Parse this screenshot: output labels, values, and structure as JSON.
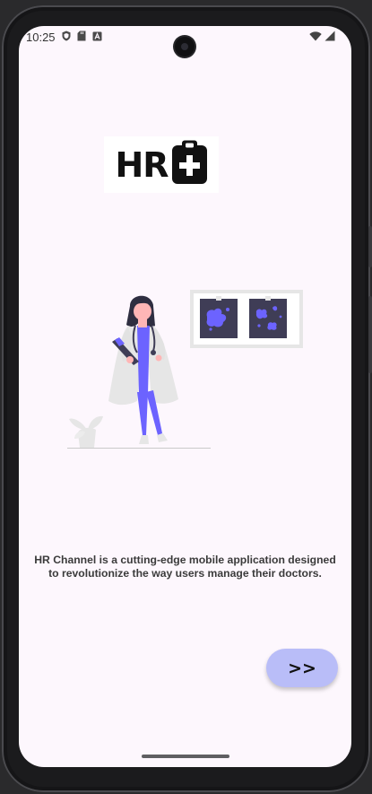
{
  "status_bar": {
    "time": "10:25",
    "left_icons": [
      "shield-icon",
      "sd-card-icon",
      "text-a-icon"
    ],
    "right_icons": [
      "wifi-icon",
      "cellular-signal-icon"
    ]
  },
  "logo": {
    "text": "HR",
    "icon": "medical-clipboard-icon"
  },
  "illustration": {
    "subject": "doctor-with-clipboard",
    "accent_color": "#6c63ff"
  },
  "description": "HR Channel is a cutting-edge mobile application designed to revolutionize the way users manage their doctors.",
  "next_button": {
    "label": ">>",
    "color": "#b9bdf8"
  },
  "colors": {
    "background": "#fdf7fd",
    "accent": "#6c63ff",
    "text": "#3b3b3b"
  }
}
